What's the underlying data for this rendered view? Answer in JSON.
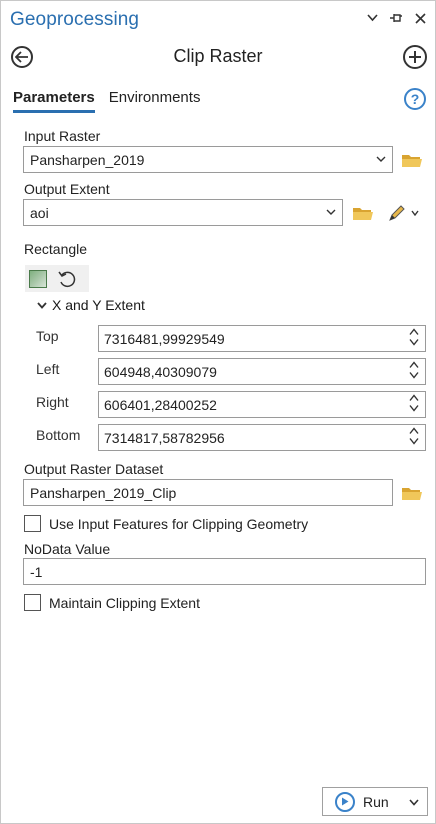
{
  "pane": {
    "title": "Geoprocessing",
    "icons": [
      "chevron-down-icon",
      "pin-icon",
      "close-icon"
    ]
  },
  "tool": {
    "title": "Clip Raster"
  },
  "tabs": [
    {
      "label": "Parameters",
      "active": true
    },
    {
      "label": "Environments",
      "active": false
    }
  ],
  "params": {
    "input_raster_label": "Input Raster",
    "input_raster_value": "Pansharpen_2019",
    "output_extent_label": "Output Extent",
    "output_extent_value": "aoi",
    "rectangle_label": "Rectangle",
    "extent_toggle_label": "X and Y Extent",
    "coords": [
      {
        "label": "Top",
        "value": "7316481,99929549"
      },
      {
        "label": "Left",
        "value": "604948,40309079"
      },
      {
        "label": "Right",
        "value": "606401,28400252"
      },
      {
        "label": "Bottom",
        "value": "7314817,58782956"
      }
    ],
    "output_dataset_label": "Output Raster Dataset",
    "output_dataset_value": "Pansharpen_2019_Clip",
    "use_input_features_label": "Use Input Features for Clipping Geometry",
    "nodata_label": "NoData Value",
    "nodata_value": "-1",
    "maintain_extent_label": "Maintain Clipping Extent"
  },
  "run": {
    "label": "Run"
  },
  "colors": {
    "accent": "#2a6fb0",
    "folder": "#e8b84a"
  }
}
